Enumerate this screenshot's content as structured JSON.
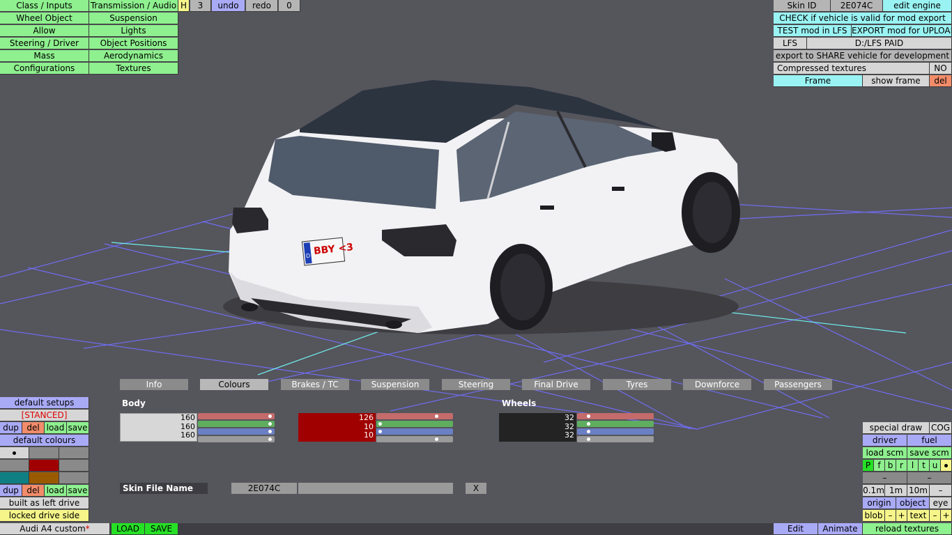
{
  "left_menu": [
    "Class / Inputs",
    "Transmission / Audio",
    "Wheel Object",
    "Suspension",
    "Allow",
    "Lights",
    "Steering / Driver",
    "Object Positions",
    "Mass",
    "Aerodynamics",
    "Configurations",
    "Textures"
  ],
  "top_toolbar": {
    "h": "H",
    "num": "3",
    "undo": "undo",
    "redo": "redo",
    "count": "0"
  },
  "right_panel": {
    "skin_id_label": "Skin ID",
    "skin_id_value": "2E074C",
    "edit_engine": "edit engine",
    "check_valid": "CHECK if vehicle is valid for mod export",
    "test_mod": "TEST mod in LFS",
    "export_upload": "EXPORT mod for UPLOAD",
    "lfs": "LFS",
    "lfs_path": "D:/LFS PAID",
    "export_share": "export to SHARE vehicle for development",
    "compressed": "Compressed textures",
    "compressed_value": "NO",
    "frame": "Frame",
    "show_frame": "show frame",
    "del": "del"
  },
  "tabs": [
    "Info",
    "Colours",
    "Brakes / TC",
    "Suspension",
    "Steering",
    "Final Drive",
    "Tyres",
    "Downforce",
    "Passengers"
  ],
  "active_tab": "Colours",
  "colours": {
    "body_label": "Body",
    "wheels_label": "Wheels",
    "body": {
      "r": "160",
      "g": "160",
      "b": "160",
      "color": "#d7d7d7",
      "text": "#000000"
    },
    "secondary": {
      "r": "126",
      "g": "10",
      "b": "10",
      "color": "#a00000",
      "text": "#ffffff"
    },
    "wheels": {
      "r": "32",
      "g": "32",
      "b": "32",
      "color": "#232323",
      "text": "#ffffff"
    }
  },
  "skin": {
    "label": "Skin File Name",
    "value": "2E074C",
    "clear": "X"
  },
  "left_bottom": {
    "default_setups": "default setups",
    "stanced": "[STANCED]",
    "dup": "dup",
    "del": "del",
    "load": "load",
    "save": "save",
    "default_colours": "default colours",
    "built_left": "built as left drive",
    "locked_side": "locked drive side",
    "car_name": "Audi A4 custom",
    "modified_mark": "*",
    "load_btn": "LOAD",
    "save_btn": "SAVE"
  },
  "right_bottom": {
    "special_draw": "special draw",
    "cog": "COG",
    "driver": "driver",
    "fuel": "fuel",
    "load_scm": "load scm",
    "save_scm": "save scm",
    "letters": [
      "P",
      "f",
      "b",
      "r",
      "l",
      "t",
      "u"
    ],
    "minus": "–",
    "m01": "0.1m",
    "m1": "1m",
    "m10": "10m",
    "origin": "origin",
    "object": "object",
    "eye": "eye",
    "blob": "blob",
    "plus": "+",
    "text": "text",
    "edit": "Edit",
    "animate": "Animate",
    "reload": "reload textures"
  },
  "plate": {
    "text": "BBY <3",
    "country": "D"
  }
}
